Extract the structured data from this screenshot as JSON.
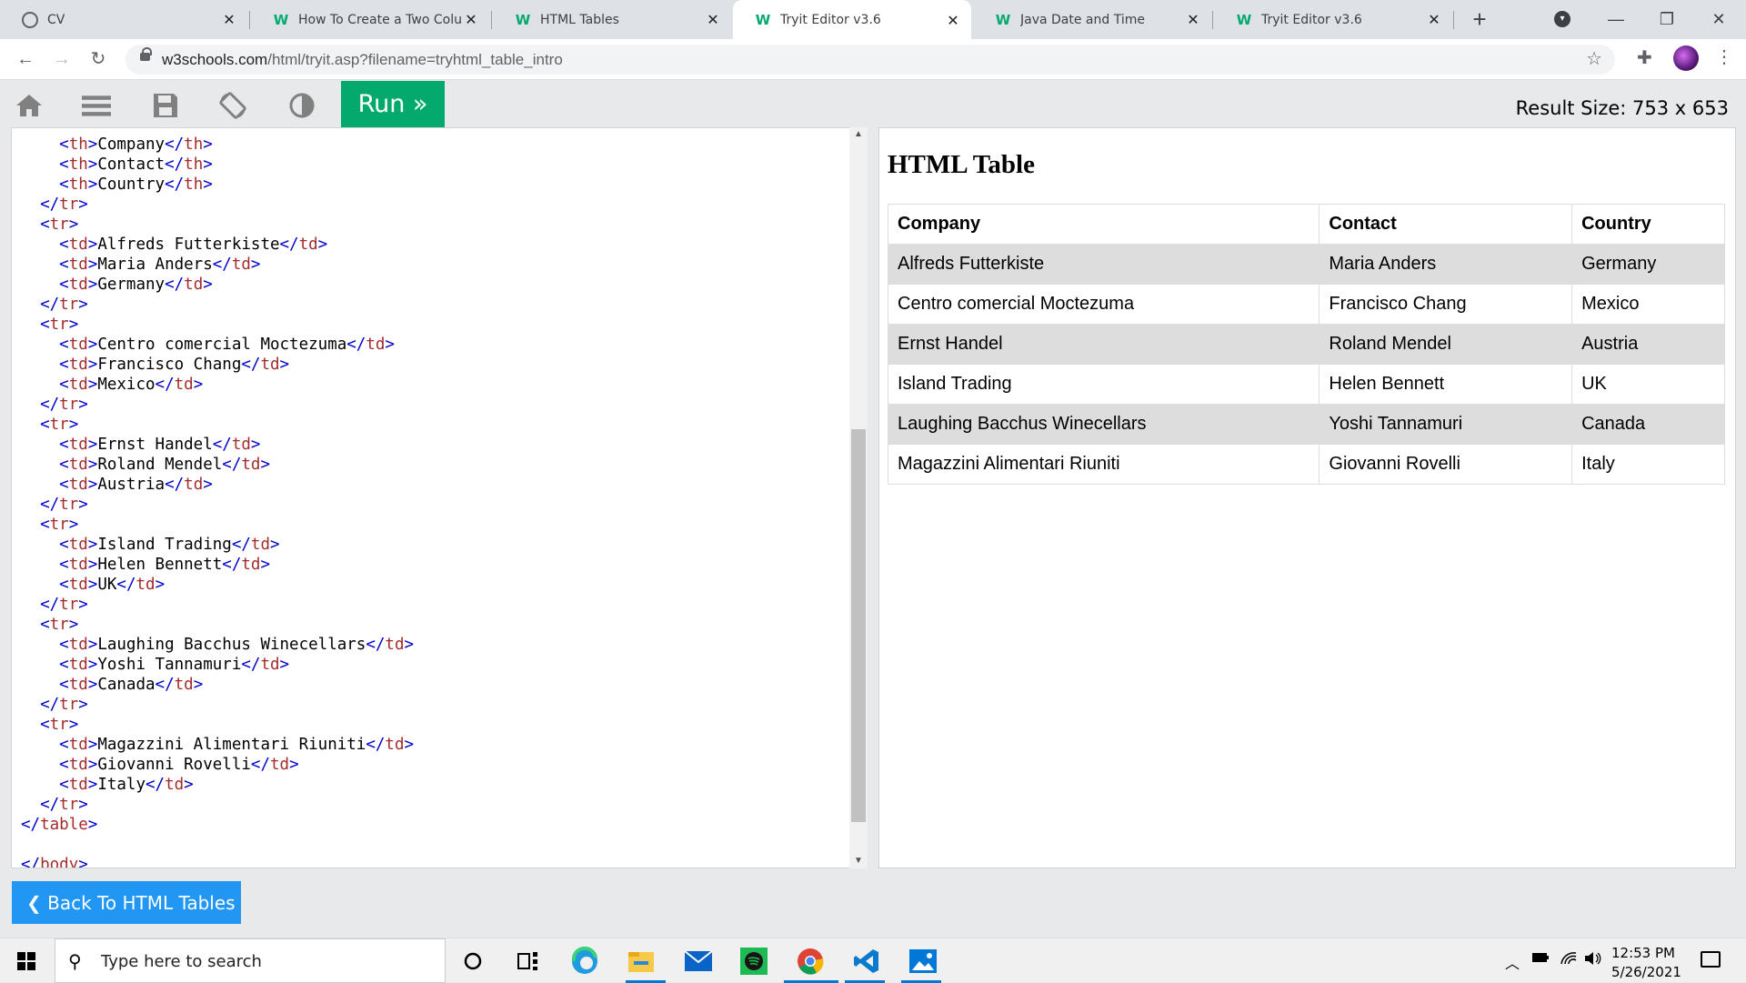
{
  "browser": {
    "tabs": [
      {
        "title": "CV",
        "favicon": "globe-icon"
      },
      {
        "title": "How To Create a Two Colum",
        "favicon": "w3schools-icon"
      },
      {
        "title": "HTML Tables",
        "favicon": "w3schools-icon"
      },
      {
        "title": "Tryit Editor v3.6",
        "favicon": "w3schools-icon",
        "active": true
      },
      {
        "title": "Java Date and Time",
        "favicon": "w3schools-icon"
      },
      {
        "title": "Tryit Editor v3.6",
        "favicon": "w3schools-icon"
      }
    ],
    "url_host": "w3schools.com",
    "url_path": "/html/tryit.asp?filename=tryhtml_table_intro"
  },
  "editor": {
    "run_label": "Run »",
    "result_size": "Result Size: 753 x 653",
    "code_lines": [
      "    <th>Company</th>",
      "    <th>Contact</th>",
      "    <th>Country</th>",
      "  </tr>",
      "  <tr>",
      "    <td>Alfreds Futterkiste</td>",
      "    <td>Maria Anders</td>",
      "    <td>Germany</td>",
      "  </tr>",
      "  <tr>",
      "    <td>Centro comercial Moctezuma</td>",
      "    <td>Francisco Chang</td>",
      "    <td>Mexico</td>",
      "  </tr>",
      "  <tr>",
      "    <td>Ernst Handel</td>",
      "    <td>Roland Mendel</td>",
      "    <td>Austria</td>",
      "  </tr>",
      "  <tr>",
      "    <td>Island Trading</td>",
      "    <td>Helen Bennett</td>",
      "    <td>UK</td>",
      "  </tr>",
      "  <tr>",
      "    <td>Laughing Bacchus Winecellars</td>",
      "    <td>Yoshi Tannamuri</td>",
      "    <td>Canada</td>",
      "  </tr>",
      "  <tr>",
      "    <td>Magazzini Alimentari Riuniti</td>",
      "    <td>Giovanni Rovelli</td>",
      "    <td>Italy</td>",
      "  </tr>",
      "</table>",
      "",
      "</body>"
    ]
  },
  "result": {
    "title": "HTML Table",
    "headers": [
      "Company",
      "Contact",
      "Country"
    ],
    "rows": [
      [
        "Alfreds Futterkiste",
        "Maria Anders",
        "Germany"
      ],
      [
        "Centro comercial Moctezuma",
        "Francisco Chang",
        "Mexico"
      ],
      [
        "Ernst Handel",
        "Roland Mendel",
        "Austria"
      ],
      [
        "Island Trading",
        "Helen Bennett",
        "UK"
      ],
      [
        "Laughing Bacchus Winecellars",
        "Yoshi Tannamuri",
        "Canada"
      ],
      [
        "Magazzini Alimentari Riuniti",
        "Giovanni Rovelli",
        "Italy"
      ]
    ]
  },
  "back_button": {
    "label": "❮ Back To HTML Tables"
  },
  "taskbar": {
    "search_placeholder": "Type here to search",
    "time": "12:53 PM",
    "date": "5/26/2021"
  },
  "colors": {
    "w3_green": "#04aa6d",
    "back_blue": "#2196f3",
    "tag": "#a52a2a",
    "bracket": "#0000cd"
  }
}
